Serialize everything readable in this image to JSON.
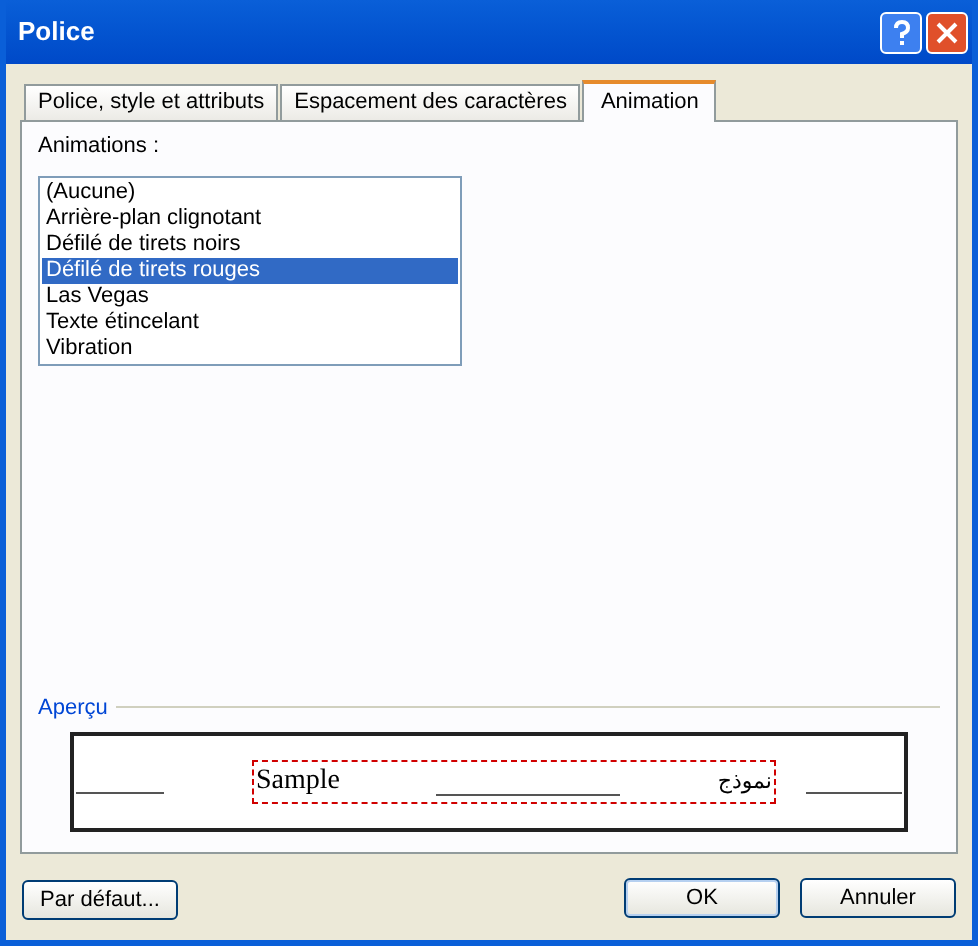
{
  "window": {
    "title": "Police"
  },
  "tabs": [
    {
      "label": "Police, style et attributs",
      "selected": false
    },
    {
      "label": "Espacement des caractères",
      "selected": false
    },
    {
      "label": "Animation",
      "selected": true
    }
  ],
  "animations": {
    "label": "Animations :",
    "items": [
      {
        "label": "(Aucune)",
        "selected": false
      },
      {
        "label": "Arrière-plan clignotant",
        "selected": false
      },
      {
        "label": "Défilé de tirets noirs",
        "selected": false
      },
      {
        "label": "Défilé de tirets rouges",
        "selected": true
      },
      {
        "label": "Las Vegas",
        "selected": false
      },
      {
        "label": "Texte étincelant",
        "selected": false
      },
      {
        "label": "Vibration",
        "selected": false
      }
    ]
  },
  "preview": {
    "label": "Aperçu",
    "sample": "Sample",
    "rtl_sample": "نموذج"
  },
  "buttons": [
    {
      "label": "Par défaut...",
      "kind": "left"
    },
    {
      "label": "OK",
      "kind": "default"
    },
    {
      "label": "Annuler",
      "kind": "normal"
    }
  ]
}
